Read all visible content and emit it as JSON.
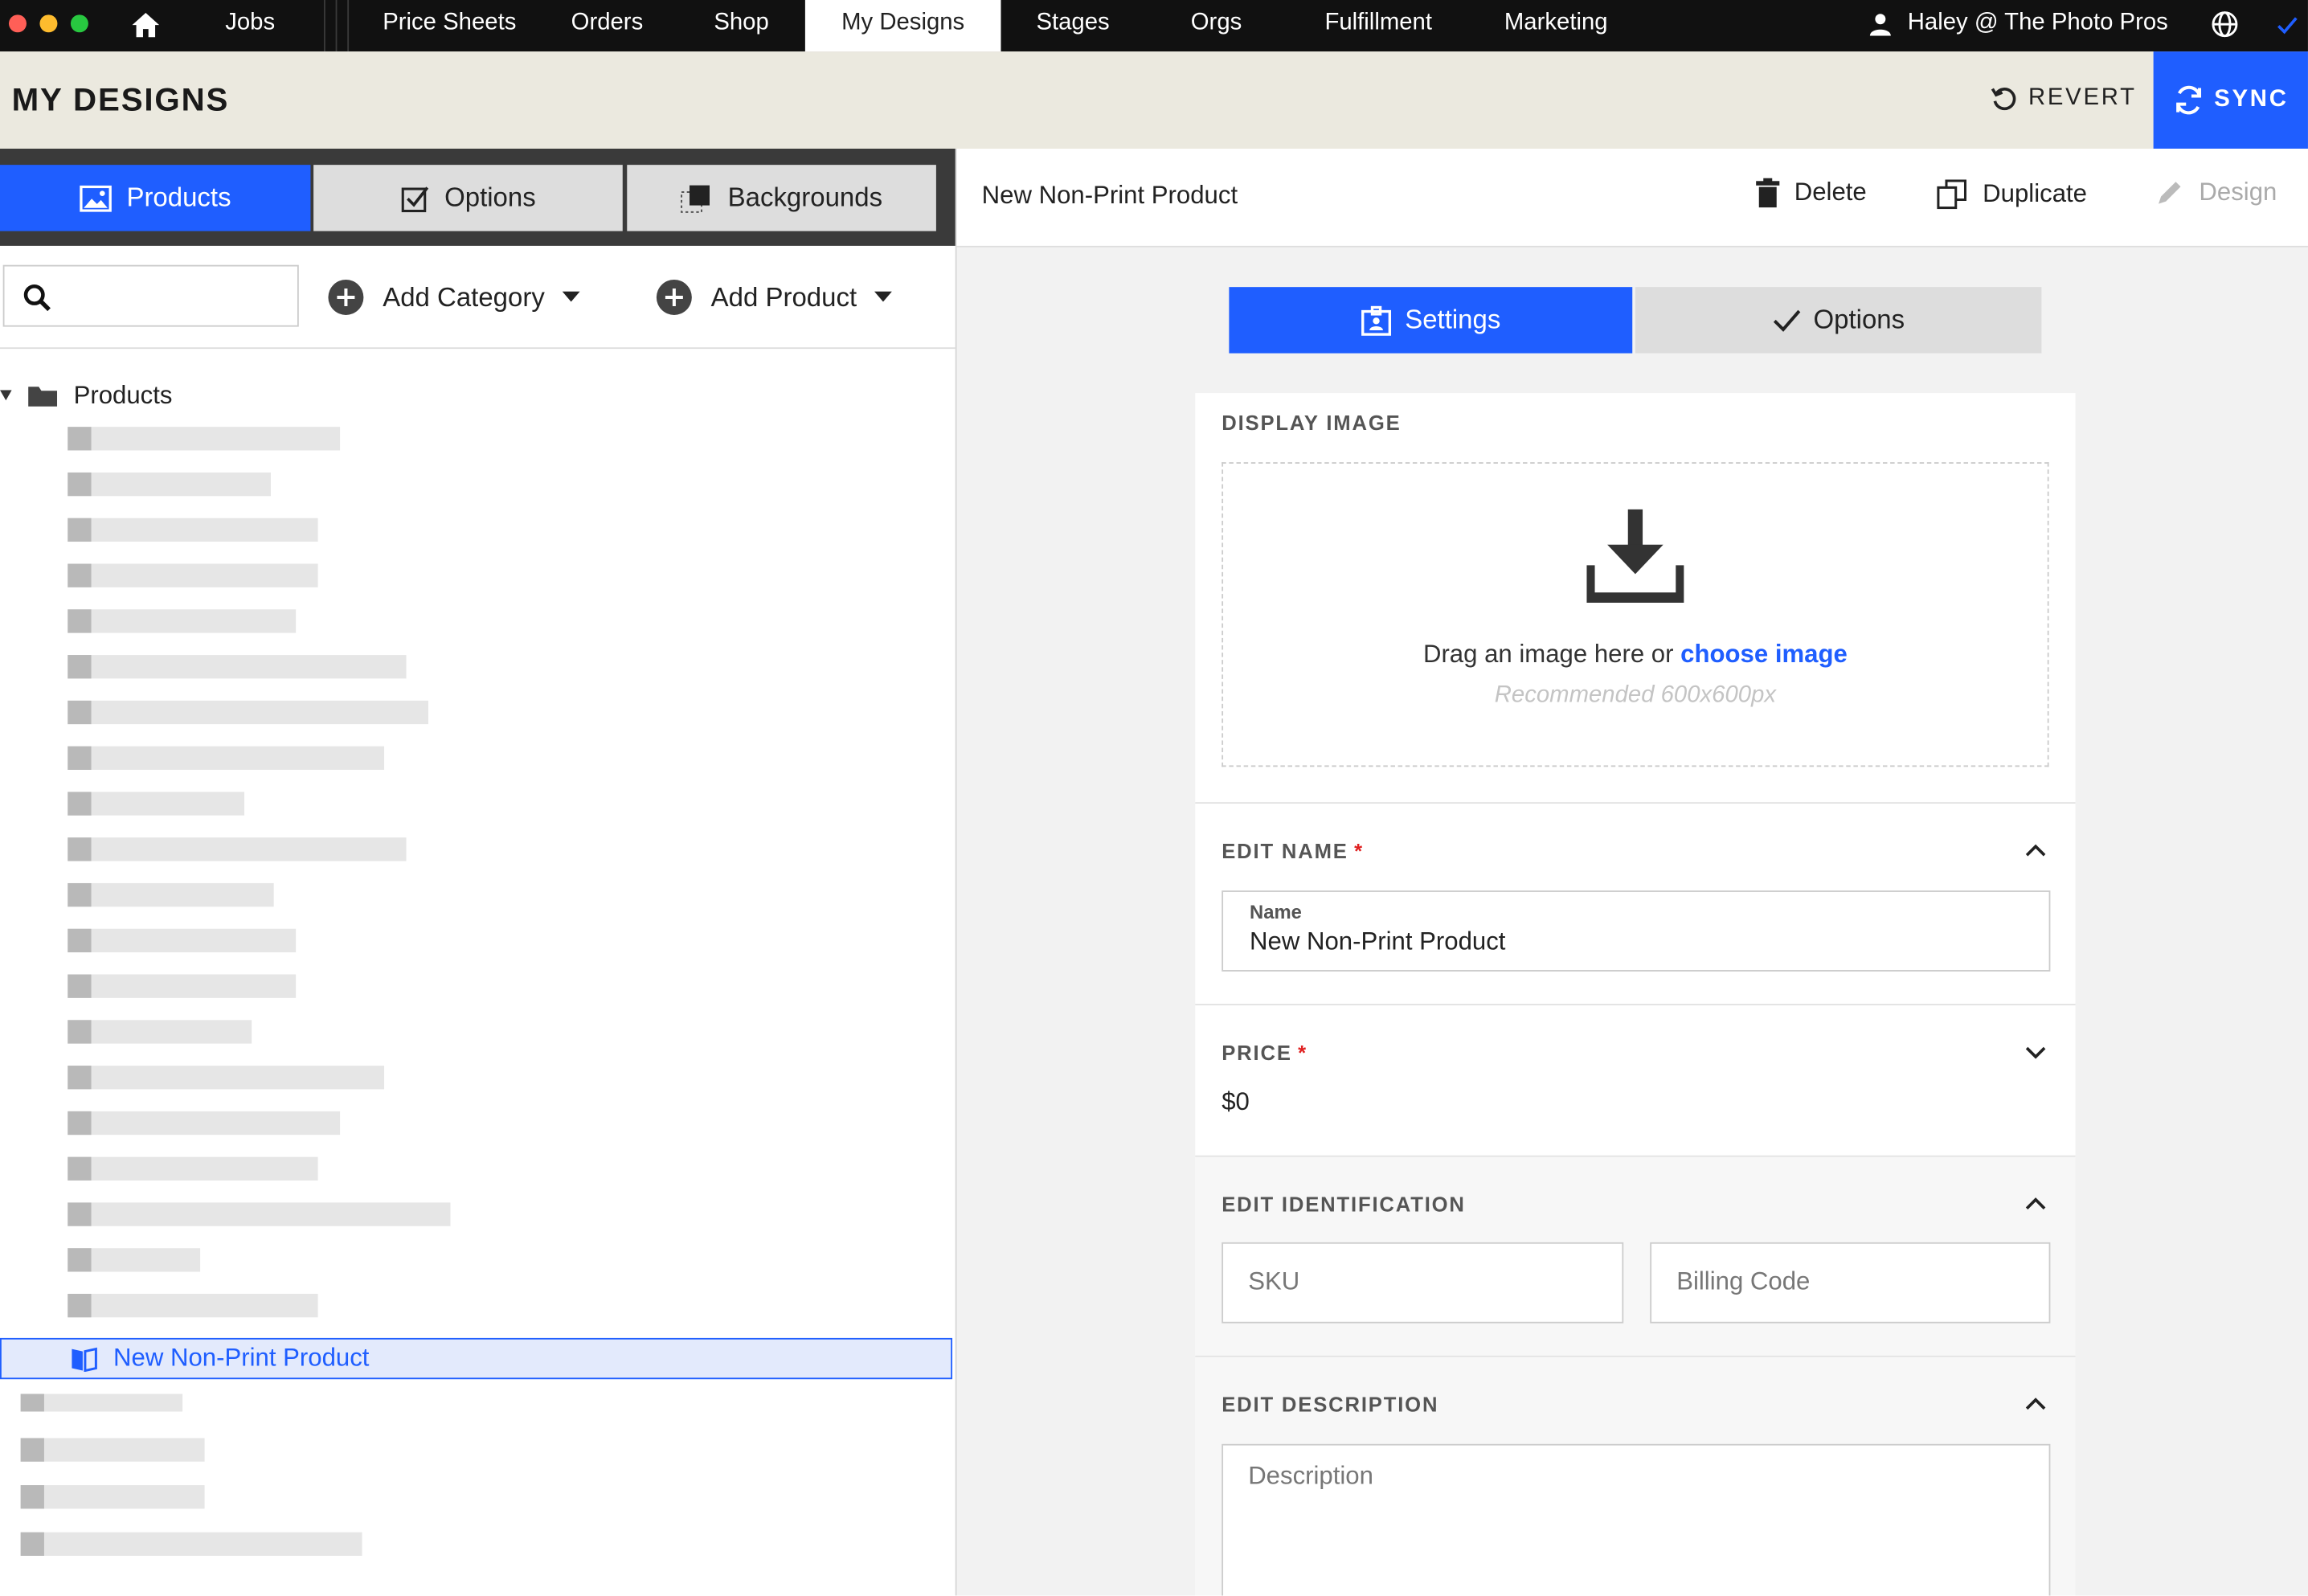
{
  "nav": {
    "tabs": [
      "Jobs",
      "Price Sheets",
      "Orders",
      "Shop",
      "My Designs",
      "Stages",
      "Orgs",
      "Fulfillment",
      "Marketing"
    ],
    "active_tab": "My Designs",
    "user": "Haley @ The Photo Pros",
    "icons": [
      "home-icon",
      "user-icon",
      "globe-icon",
      "check-icon"
    ]
  },
  "header": {
    "title": "MY DESIGNS",
    "revert_label": "REVERT",
    "sync_label": "SYNC"
  },
  "left": {
    "tabs": [
      "Products",
      "Options",
      "Backgrounds"
    ],
    "active_tab": "Products",
    "add_category_label": "Add Category",
    "add_product_label": "Add Product",
    "tree_root_label": "Products",
    "selected_item_label": "New Non-Print Product"
  },
  "right": {
    "product_title": "New Non-Print Product",
    "delete_label": "Delete",
    "duplicate_label": "Duplicate",
    "design_label": "Design",
    "tabs": [
      "Settings",
      "Options"
    ],
    "active_tab": "Settings",
    "display_image": {
      "title": "DISPLAY IMAGE",
      "drag_text": "Drag an image here or",
      "choose_link": "choose image",
      "recommended": "Recommended 600x600px"
    },
    "edit_name": {
      "title": "EDIT NAME",
      "required_mark": "*",
      "field_label": "Name",
      "field_value": "New Non-Print Product"
    },
    "price": {
      "title": "PRICE",
      "required_mark": "*",
      "value": "$0"
    },
    "identification": {
      "title": "EDIT IDENTIFICATION",
      "sku_placeholder": "SKU",
      "billing_placeholder": "Billing Code"
    },
    "description": {
      "title": "EDIT DESCRIPTION",
      "placeholder": "Description"
    }
  },
  "colors": {
    "accent": "#1f5eff",
    "nav_bg": "#111111",
    "header_bg": "#ebe9df",
    "required": "#e02020"
  }
}
